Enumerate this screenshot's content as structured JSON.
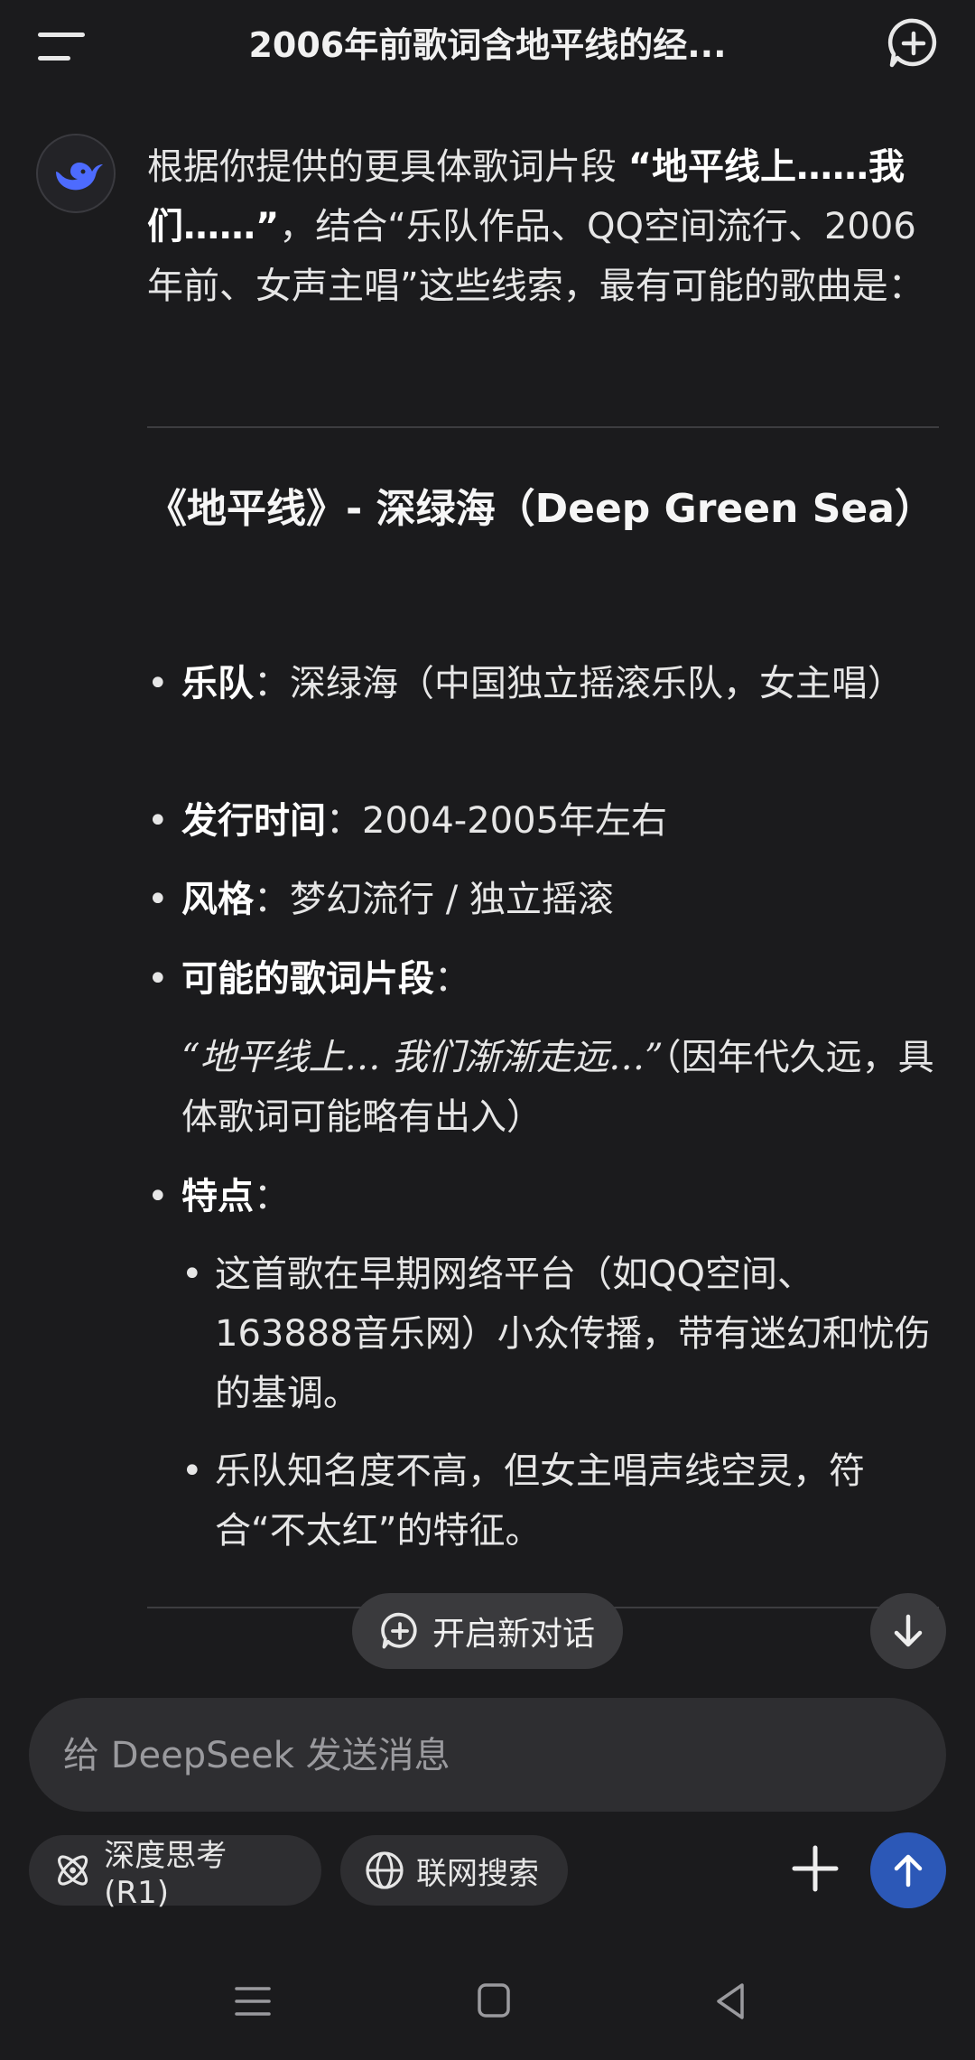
{
  "header": {
    "title": "2006年前歌词含地平线的经..."
  },
  "message": {
    "intro_prefix": "根据你提供的更具体歌词片段 ",
    "intro_bold": "“地平线上……我们……”",
    "intro_suffix": "，结合“乐队作品、QQ空间流行、2006年前、女声主唱”这些线索，最有可能的歌曲是：",
    "song_title": "《地平线》- 深绿海（Deep Green Sea）",
    "items": [
      {
        "label": "乐队",
        "value": "：深绿海（中国独立摇滚乐队，女主唱）"
      },
      {
        "label": "发行时间",
        "value": "：2004-2005年左右"
      },
      {
        "label": "风格",
        "value": "：梦幻流行 / 独立摇滚"
      },
      {
        "label": "可能的歌词片段",
        "value": "："
      },
      {
        "label": "特点",
        "value": "："
      }
    ],
    "lyric_quote": "“地平线上… 我们渐渐走远…”",
    "lyric_note": "（因年代久远，具体歌词可能略有出入）",
    "features": [
      "这首歌在早期网络平台（如QQ空间、163888音乐网）小众传播，带有迷幻和忧伤的基调。",
      "乐队知名度不高，但女主唱声线空灵，符合“不太红”的特征。"
    ],
    "bullet": "•"
  },
  "floating": {
    "new_chat_label": "开启新对话"
  },
  "composer": {
    "placeholder": "给 DeepSeek 发送消息",
    "deep_think_label": "深度思考 (R1)",
    "web_search_label": "联网搜索"
  },
  "colors": {
    "background": "#1b1b1d",
    "accent": "#2c58b7",
    "logo": "#4d6bfe"
  }
}
